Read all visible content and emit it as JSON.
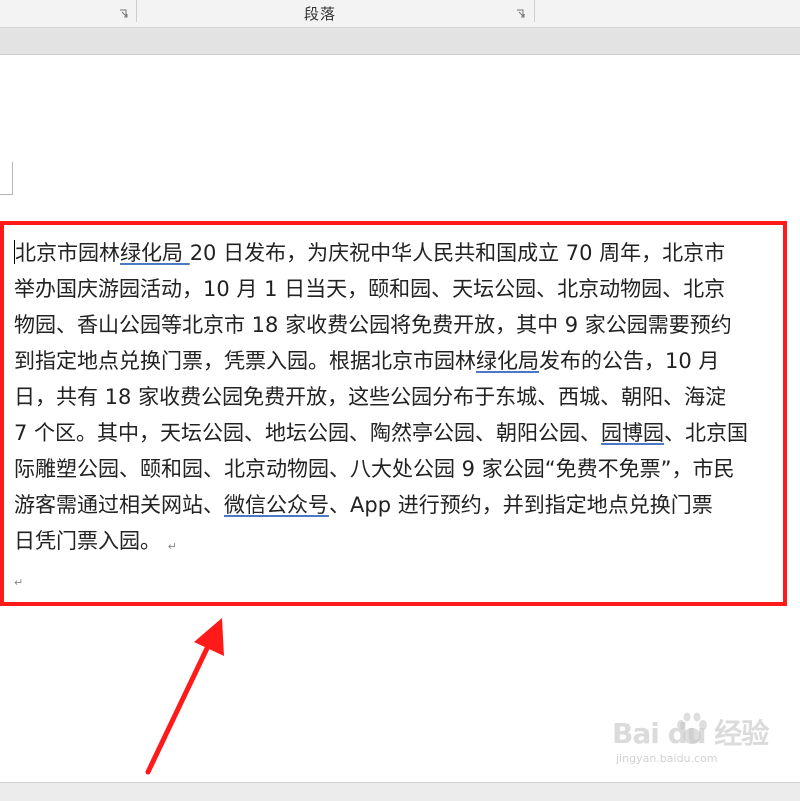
{
  "ribbon": {
    "paragraph_group_label": "段落"
  },
  "document": {
    "lines": [
      [
        {
          "t": "北京市园林",
          "u": false
        },
        {
          "t": "绿化局 ",
          "u": true
        },
        {
          "t": "20 日发布，为庆祝中华人民共和国成立 70 周年，北京市",
          "u": false
        }
      ],
      [
        {
          "t": "举办国庆游园活动，10 月 1 日当天，颐和园、天坛公园、北京动物园、北京",
          "u": false
        }
      ],
      [
        {
          "t": "物园、香山公园等北京市 18 家收费公园将免费开放，其中 9 家公园需要预约",
          "u": false
        }
      ],
      [
        {
          "t": "到指定地点兑换门票，凭票入园。根据北京市园林",
          "u": false
        },
        {
          "t": "绿化局",
          "u": true
        },
        {
          "t": "发布的公告，10 月",
          "u": false
        }
      ],
      [
        {
          "t": "日，共有 18 家收费公园免费开放，这些公园分布于东城、西城、朝阳、海淀",
          "u": false
        }
      ],
      [
        {
          "t": "7 个区。其中，天坛公园、地坛公园、陶然亭公园、朝阳公园、",
          "u": false
        },
        {
          "t": "园博园",
          "u": true
        },
        {
          "t": "、北京国",
          "u": false
        }
      ],
      [
        {
          "t": "际雕塑公园、颐和园、北京动物园、八大处公园 9 家公园“免费不免票”，市民",
          "u": false
        }
      ],
      [
        {
          "t": "游客需通过相关网站、",
          "u": false
        },
        {
          "t": "微信公众号",
          "u": true
        },
        {
          "t": "、App 进行预约，并到指定地点兑换门票",
          "u": false
        }
      ],
      [
        {
          "t": "日凭门票入园。",
          "u": false
        }
      ]
    ],
    "paragraph_mark": "↵"
  },
  "annotation": {
    "box_color": "#ff1a1a",
    "arrow_color": "#ff1a1a"
  },
  "watermark": {
    "logo_text": "Bai du 经验",
    "url_text": "jingyan.baidu.com"
  }
}
